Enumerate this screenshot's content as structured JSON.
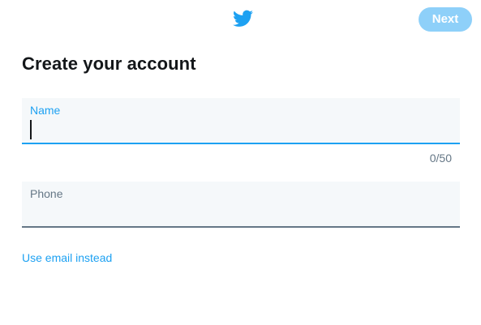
{
  "header": {
    "logo_icon": "twitter-bird-icon",
    "next_label": "Next",
    "brand_color": "#1da1f2",
    "next_disabled_color": "#8ed0f9"
  },
  "main": {
    "title": "Create your account",
    "name_field": {
      "label": "Name",
      "value": "",
      "counter": "0/50"
    },
    "phone_field": {
      "label": "Phone",
      "value": ""
    },
    "email_link": "Use email instead"
  }
}
